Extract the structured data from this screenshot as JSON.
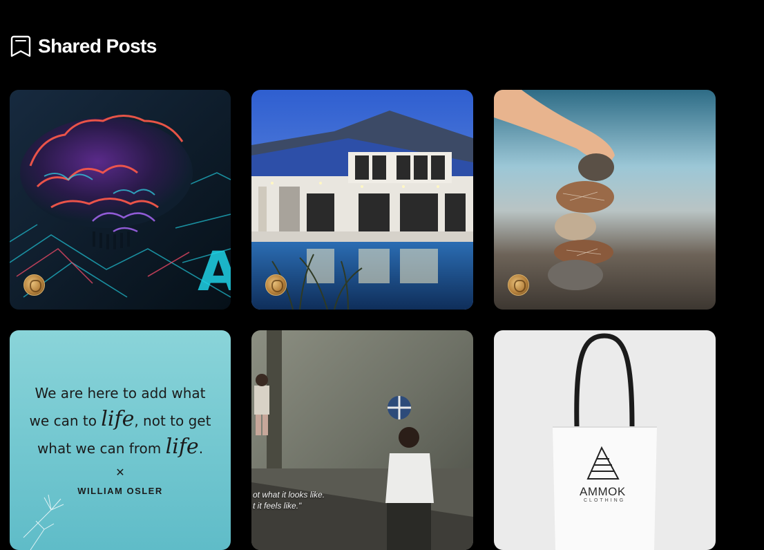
{
  "header": {
    "icon": "bookmark-icon",
    "title": "Shared Posts"
  },
  "posts": [
    {
      "subject": "circuit-brain",
      "avatar_icon": "user-avatar",
      "colors": {
        "bg": "#0d1a2a",
        "accent": "#ff3d8a",
        "glow": "#26d1e6"
      }
    },
    {
      "subject": "modern-villa-with-pool",
      "avatar_icon": "user-avatar",
      "colors": {
        "sky": "#3b6fd6",
        "pool": "#2a5f9e"
      }
    },
    {
      "subject": "stacked-pebbles",
      "avatar_icon": "user-avatar",
      "colors": {
        "water": "#7fb3c6",
        "ground": "#6a6055"
      }
    },
    {
      "subject": "quote-card",
      "quote": {
        "line1": "We are here to add what",
        "line2_start": "we can to ",
        "line2_script": "life",
        "line2_end": ", not to get",
        "line3_start": "what we can from ",
        "line3_script": "life",
        "line3_end": ".",
        "ornament": "✕",
        "author": "WILLIAM OSLER"
      },
      "colors": {
        "bg": "#7fcfd6"
      }
    },
    {
      "subject": "boy-with-ball",
      "caption": {
        "line1": "ot what it looks like.",
        "line2": "t it feels like.\""
      },
      "colors": {
        "wall": "#7a7e70"
      }
    },
    {
      "subject": "tote-bag",
      "brand": {
        "name": "AMMOK",
        "sub": "CLOTHING"
      },
      "colors": {
        "bg": "#e9e9e9"
      }
    }
  ]
}
